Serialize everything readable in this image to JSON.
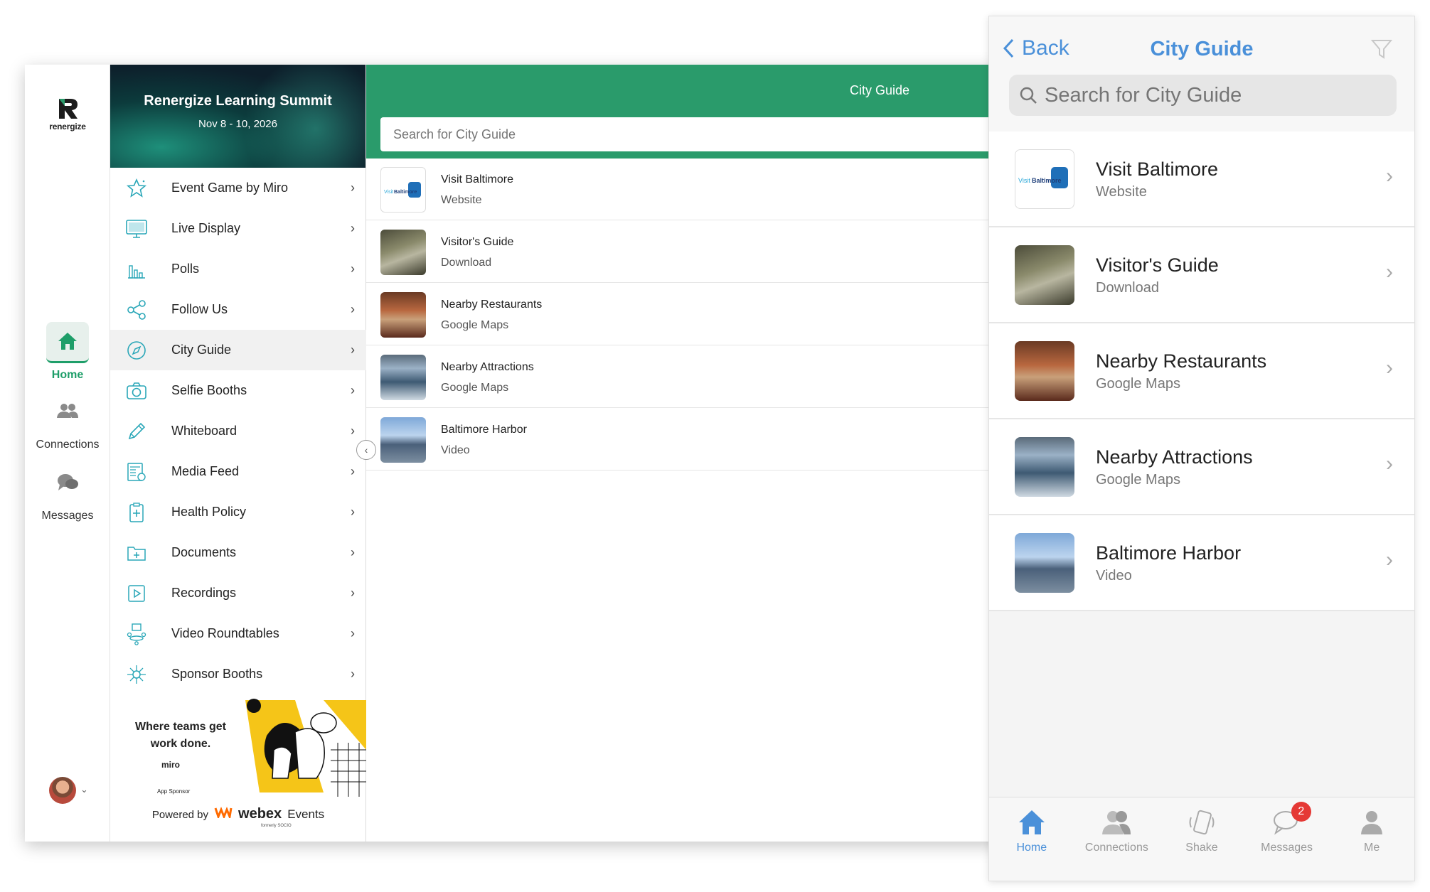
{
  "tablet": {
    "logo_text": "renergize",
    "rail": [
      {
        "label": "Home",
        "icon": "home-icon"
      },
      {
        "label": "Connections",
        "icon": "people-icon"
      },
      {
        "label": "Messages",
        "icon": "chat-icon"
      }
    ],
    "banner": {
      "title": "Renergize Learning Summit",
      "date": "Nov 8 - 10, 2026"
    },
    "menu": [
      {
        "label": "Event Game by Miro",
        "icon": "star-icon"
      },
      {
        "label": "Live Display",
        "icon": "monitor-icon"
      },
      {
        "label": "Polls",
        "icon": "bar-chart-icon"
      },
      {
        "label": "Follow Us",
        "icon": "share-icon"
      },
      {
        "label": "City Guide",
        "icon": "compass-icon"
      },
      {
        "label": "Selfie Booths",
        "icon": "camera-icon"
      },
      {
        "label": "Whiteboard",
        "icon": "pencil-icon"
      },
      {
        "label": "Media Feed",
        "icon": "news-icon"
      },
      {
        "label": "Health Policy",
        "icon": "clipboard-icon"
      },
      {
        "label": "Documents",
        "icon": "folder-icon"
      },
      {
        "label": "Recordings",
        "icon": "play-icon"
      },
      {
        "label": "Video Roundtables",
        "icon": "roundtable-icon"
      },
      {
        "label": "Sponsor Booths",
        "icon": "network-icon"
      }
    ],
    "sponsor": {
      "text": "Where teams get work done.",
      "brand": "miro",
      "tag": "App Sponsor"
    },
    "powered": {
      "by": "Powered by",
      "brand": "webex",
      "events": "Events",
      "sub": "formerly SOCIO"
    },
    "content": {
      "title": "City Guide",
      "search_placeholder": "Search for City Guide",
      "items": [
        {
          "title": "Visit Baltimore",
          "subtitle": "Website"
        },
        {
          "title": "Visitor's Guide",
          "subtitle": "Download"
        },
        {
          "title": "Nearby Restaurants",
          "subtitle": "Google Maps"
        },
        {
          "title": "Nearby Attractions",
          "subtitle": "Google Maps"
        },
        {
          "title": "Baltimore Harbor",
          "subtitle": "Video"
        }
      ]
    }
  },
  "phone": {
    "back_label": "Back",
    "title": "City Guide",
    "search_placeholder": "Search for City Guide",
    "items": [
      {
        "title": "Visit Baltimore",
        "subtitle": "Website"
      },
      {
        "title": "Visitor's Guide",
        "subtitle": "Download"
      },
      {
        "title": "Nearby Restaurants",
        "subtitle": "Google Maps"
      },
      {
        "title": "Nearby Attractions",
        "subtitle": "Google Maps"
      },
      {
        "title": "Baltimore Harbor",
        "subtitle": "Video"
      }
    ],
    "tabs": [
      {
        "label": "Home",
        "icon": "home-icon"
      },
      {
        "label": "Connections",
        "icon": "people-icon"
      },
      {
        "label": "Shake",
        "icon": "phone-shake-icon"
      },
      {
        "label": "Messages",
        "icon": "chat-icon",
        "badge": "2"
      },
      {
        "label": "Me",
        "icon": "person-icon"
      }
    ]
  },
  "colors": {
    "brand_green": "#2a9b6b",
    "phone_accent": "#4a90d9",
    "icon_teal": "#2aa7b8",
    "badge_red": "#e53935"
  }
}
